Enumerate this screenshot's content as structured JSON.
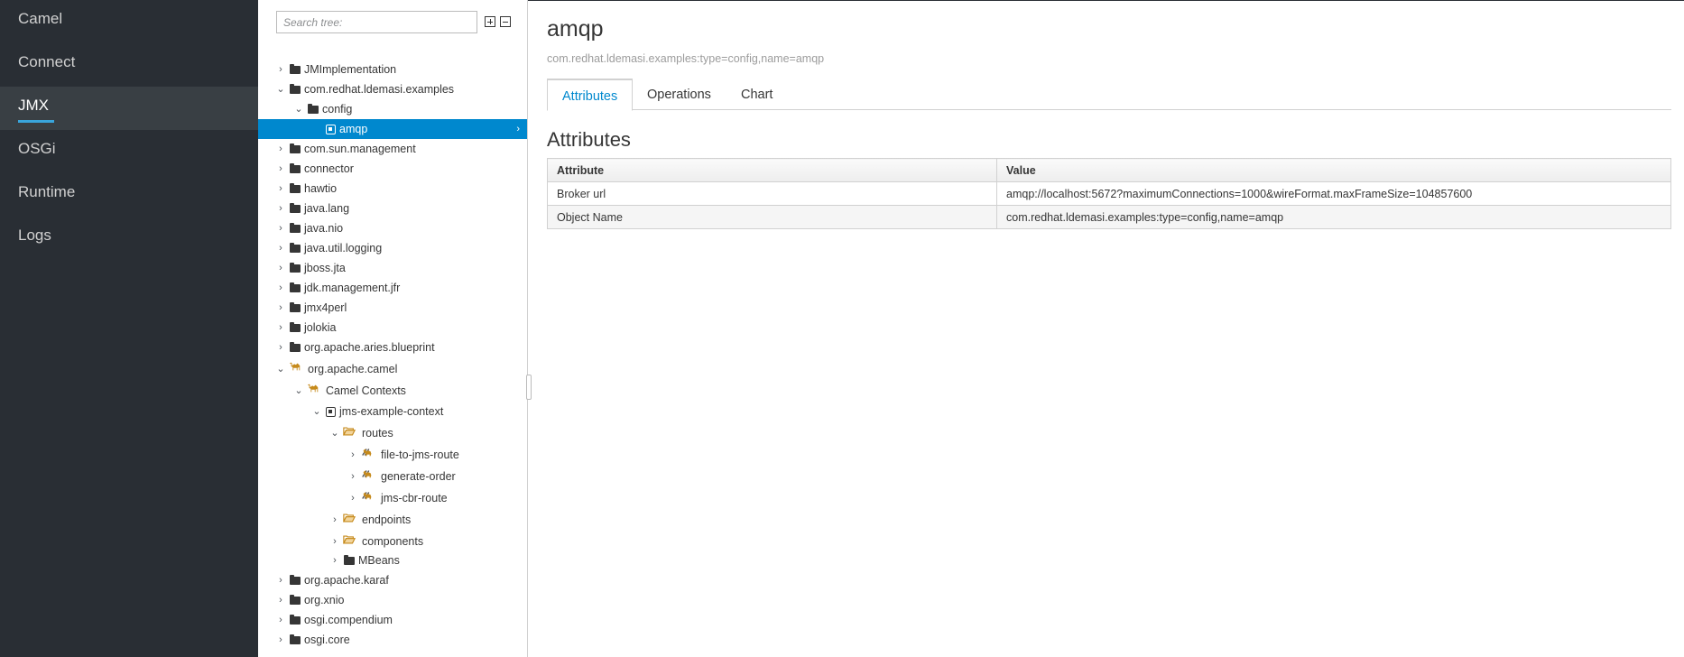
{
  "nav": {
    "items": [
      {
        "label": "Camel"
      },
      {
        "label": "Connect"
      },
      {
        "label": "JMX",
        "active": true
      },
      {
        "label": "OSGi"
      },
      {
        "label": "Runtime"
      },
      {
        "label": "Logs"
      }
    ]
  },
  "tree": {
    "search_placeholder": "Search tree:",
    "nodes": [
      {
        "label": "JMImplementation",
        "icon": "folder-icon",
        "expanded": false
      },
      {
        "label": "com.redhat.ldemasi.examples",
        "icon": "folder-icon",
        "expanded": true
      },
      {
        "label": "config",
        "icon": "folder-icon",
        "expanded": true
      },
      {
        "label": "amqp",
        "icon": "cube-icon",
        "selected": true
      },
      {
        "label": "com.sun.management",
        "icon": "folder-icon",
        "expanded": false
      },
      {
        "label": "connector",
        "icon": "folder-icon",
        "expanded": false
      },
      {
        "label": "hawtio",
        "icon": "folder-icon",
        "expanded": false
      },
      {
        "label": "java.lang",
        "icon": "folder-icon",
        "expanded": false
      },
      {
        "label": "java.nio",
        "icon": "folder-icon",
        "expanded": false
      },
      {
        "label": "java.util.logging",
        "icon": "folder-icon",
        "expanded": false
      },
      {
        "label": "jboss.jta",
        "icon": "folder-icon",
        "expanded": false
      },
      {
        "label": "jdk.management.jfr",
        "icon": "folder-icon",
        "expanded": false
      },
      {
        "label": "jmx4perl",
        "icon": "folder-icon",
        "expanded": false
      },
      {
        "label": "jolokia",
        "icon": "folder-icon",
        "expanded": false
      },
      {
        "label": "org.apache.aries.blueprint",
        "icon": "folder-icon",
        "expanded": false
      },
      {
        "label": "org.apache.camel",
        "icon": "camel-icon",
        "expanded": true
      },
      {
        "label": "Camel Contexts",
        "icon": "camel-icon",
        "expanded": true
      },
      {
        "label": "jms-example-context",
        "icon": "cube-icon",
        "expanded": true
      },
      {
        "label": "routes",
        "icon": "open-folder-icon",
        "expanded": true
      },
      {
        "label": "file-to-jms-route",
        "icon": "route-icon",
        "expanded": false
      },
      {
        "label": "generate-order",
        "icon": "route-icon",
        "expanded": false
      },
      {
        "label": "jms-cbr-route",
        "icon": "route-icon",
        "expanded": false
      },
      {
        "label": "endpoints",
        "icon": "open-folder-icon",
        "expanded": false
      },
      {
        "label": "components",
        "icon": "open-folder-icon",
        "expanded": false
      },
      {
        "label": "MBeans",
        "icon": "folder-icon",
        "expanded": false
      },
      {
        "label": "org.apache.karaf",
        "icon": "folder-icon",
        "expanded": false
      },
      {
        "label": "org.xnio",
        "icon": "folder-icon",
        "expanded": false
      },
      {
        "label": "osgi.compendium",
        "icon": "folder-icon",
        "expanded": false
      },
      {
        "label": "osgi.core",
        "icon": "folder-icon",
        "expanded": false
      }
    ]
  },
  "main": {
    "title": "amqp",
    "object_name": "com.redhat.ldemasi.examples:type=config,name=amqp",
    "tabs": [
      {
        "label": "Attributes",
        "active": true
      },
      {
        "label": "Operations"
      },
      {
        "label": "Chart"
      }
    ],
    "section_title": "Attributes",
    "table": {
      "headers": [
        "Attribute",
        "Value"
      ],
      "rows": [
        [
          "Broker url",
          "amqp://localhost:5672?maximumConnections=1000&wireFormat.maxFrameSize=104857600"
        ],
        [
          "Object Name",
          "com.redhat.ldemasi.examples:type=config,name=amqp"
        ]
      ]
    }
  },
  "colors": {
    "nav_bg": "#292e34",
    "nav_active_bg": "#393f44",
    "accent": "#0088ce",
    "underline": "#39a5dc",
    "camel_orange": "#c68a1b"
  }
}
